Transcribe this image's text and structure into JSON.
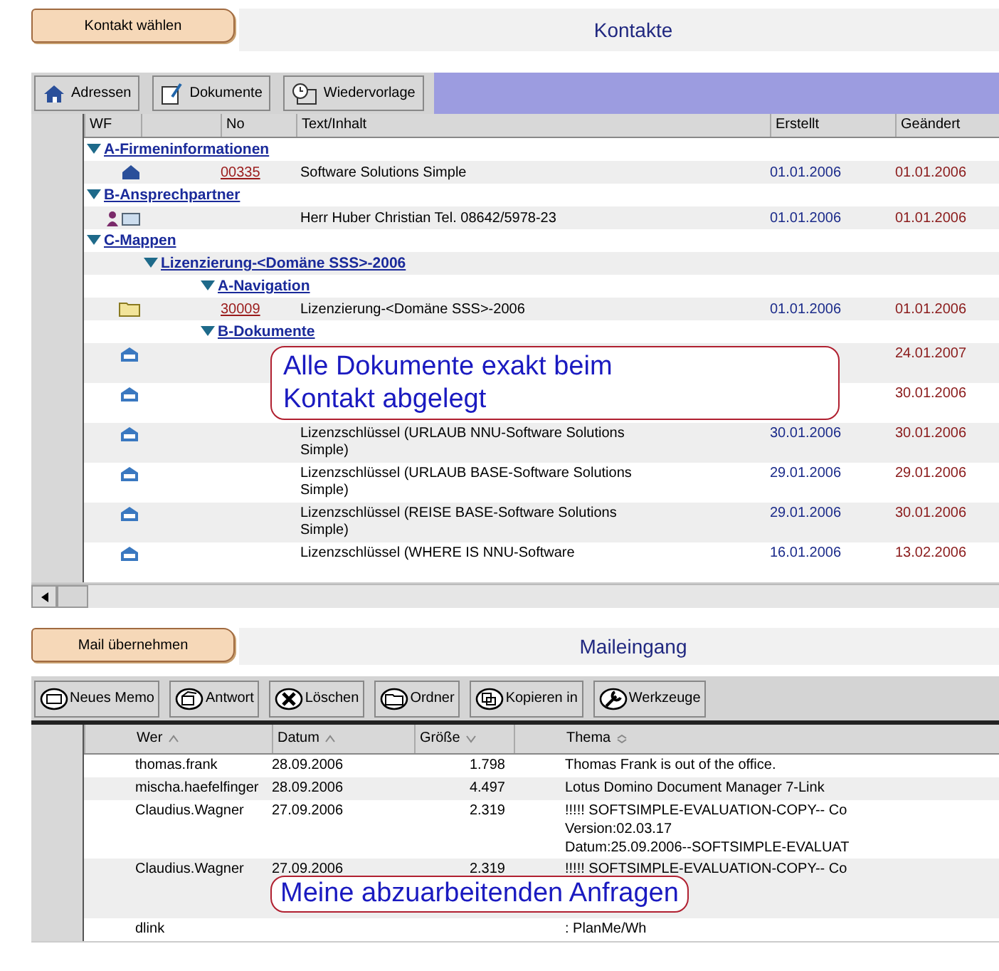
{
  "contacts": {
    "action_button": "Kontakt wählen",
    "title": "Kontakte",
    "toolbar": [
      {
        "kind": "house",
        "label": "Adressen"
      },
      {
        "kind": "document",
        "label": "Dokumente"
      },
      {
        "kind": "clock",
        "label": "Wiedervorlage"
      }
    ],
    "columns": [
      "WF",
      "No",
      "Text/Inhalt",
      "Erstellt",
      "Geändert"
    ],
    "tree": [
      {
        "kind": "group",
        "label": "A-Firmeninformationen",
        "expanded": true,
        "children": [
          {
            "kind": "company",
            "no": "00335",
            "text": "Software Solutions Simple",
            "created": "01.01.2006",
            "changed": "01.01.2006"
          }
        ]
      },
      {
        "kind": "group",
        "label": "B-Ansprechpartner",
        "expanded": true,
        "children": [
          {
            "kind": "person",
            "text": "Herr Huber Christian Tel. 08642/5978-23",
            "created": "01.01.2006",
            "changed": "01.01.2006"
          }
        ]
      },
      {
        "kind": "group",
        "label": "C-Mappen",
        "expanded": true,
        "children": [
          {
            "kind": "group",
            "label": "Lizenzierung-<Domäne SSS>-2006",
            "expanded": true,
            "children": [
              {
                "kind": "group",
                "label": "A-Navigation",
                "expanded": true,
                "children": [
                  {
                    "kind": "folder",
                    "no": "30009",
                    "text": "Lizenzierung-<Domäne SSS>-2006",
                    "created": "01.01.2006",
                    "changed": "01.01.2006"
                  }
                ]
              },
              {
                "kind": "group",
                "label": "B-Dokumente",
                "expanded": true,
                "children": [
                  {
                    "kind": "doc",
                    "changed": "24.01.2007"
                  },
                  {
                    "kind": "doc",
                    "changed": "30.01.2006"
                  },
                  {
                    "kind": "doc",
                    "text": "Lizenzschlüssel  (URLAUB NNU-Software Solutions Simple)",
                    "created": "30.01.2006",
                    "changed": "30.01.2006"
                  },
                  {
                    "kind": "doc",
                    "text": "Lizenzschlüssel  (URLAUB BASE-Software Solutions Simple)",
                    "created": "29.01.2006",
                    "changed": "29.01.2006"
                  },
                  {
                    "kind": "doc",
                    "text": "Lizenzschlüssel  (REISE BASE-Software Solutions Simple)",
                    "created": "29.01.2006",
                    "changed": "30.01.2006"
                  },
                  {
                    "kind": "doc",
                    "text": "Lizenzschlüssel  (WHERE IS NNU-Software",
                    "created": "16.01.2006",
                    "changed": "13.02.2006"
                  }
                ]
              }
            ]
          }
        ]
      }
    ],
    "callout": [
      "Alle Dokumente exakt beim",
      "Kontakt abgelegt"
    ]
  },
  "mail": {
    "action_button": "Mail übernehmen",
    "title": "Maileingang",
    "toolbar": [
      {
        "kind": "memo",
        "label": "Neues Memo"
      },
      {
        "kind": "reply",
        "label": "Antwort"
      },
      {
        "kind": "delete",
        "label": "Löschen"
      },
      {
        "kind": "folder",
        "label": "Ordner"
      },
      {
        "kind": "copy",
        "label": "Kopieren in"
      },
      {
        "kind": "wrench",
        "label": "Werkzeuge"
      }
    ],
    "columns": [
      {
        "label": "Wer",
        "kind": "ascending"
      },
      {
        "label": "Datum",
        "kind": "ascending"
      },
      {
        "label": "Größe",
        "kind": "descending"
      },
      {
        "label": "Thema",
        "kind": "sortable"
      }
    ],
    "rows": [
      {
        "from": "thomas.frank",
        "date": "28.09.2006",
        "size": "1.798",
        "subject": [
          "Thomas Frank  is out of the office."
        ]
      },
      {
        "from": "mischa.haefelfinger",
        "date": "28.09.2006",
        "size": "4.497",
        "subject": [
          "Lotus Domino Document Manager 7-Link"
        ]
      },
      {
        "from": "Claudius.Wagner",
        "date": "27.09.2006",
        "size": "2.319",
        "subject": [
          "!!!!!   SOFTSIMPLE-EVALUATION-COPY-- Co",
          "Version:02.03.17",
          "Datum:25.09.2006--SOFTSIMPLE-EVALUAT"
        ]
      },
      {
        "from": "Claudius.Wagner",
        "date": "27.09.2006",
        "size": "2.319",
        "subject": [
          "!!!!!   SOFTSIMPLE-EVALUATION-COPY-- Co"
        ]
      },
      {
        "from": "dlink",
        "subject": [
          ": PlanMe/Wh"
        ]
      }
    ],
    "callout": "Meine abzuarbeitenden Anfragen"
  }
}
